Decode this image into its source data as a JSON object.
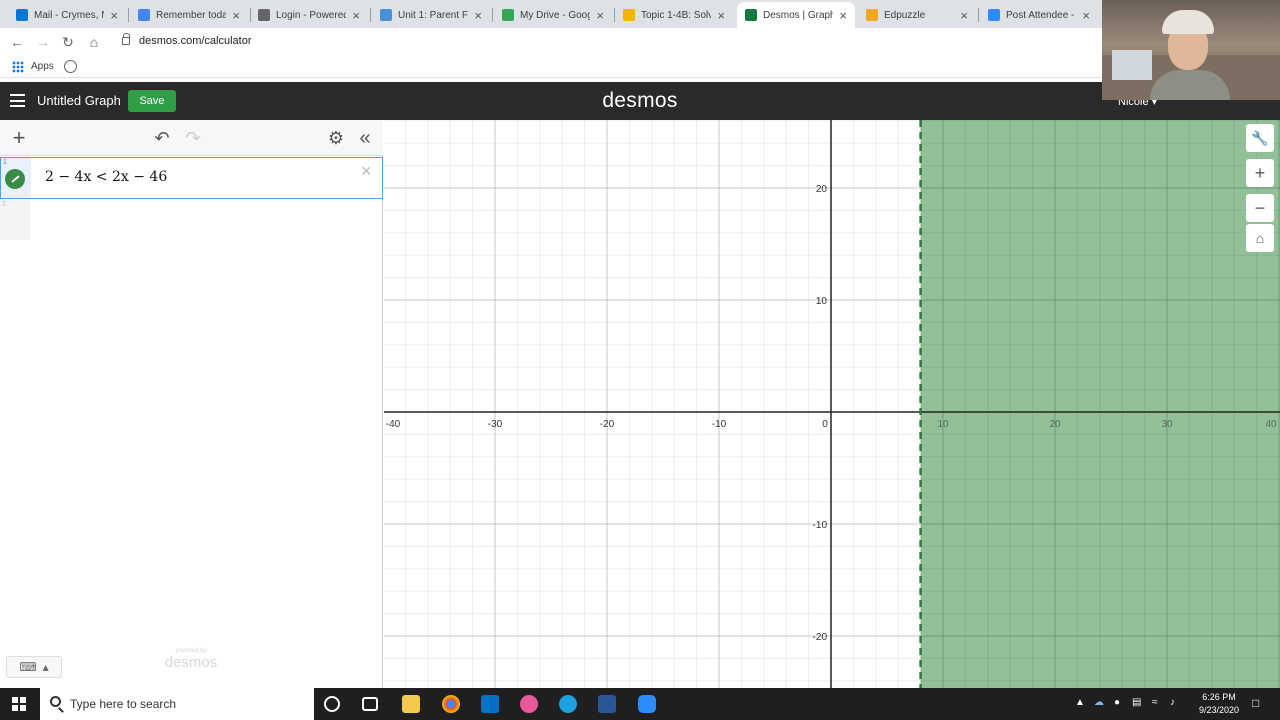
{
  "browser": {
    "tabs": [
      {
        "title": "Mail - Crymes, N",
        "color": "#0078d4"
      },
      {
        "title": "Remember toda",
        "color": "#4285f4"
      },
      {
        "title": "Login - Powered",
        "color": "#666666"
      },
      {
        "title": "Unit 1: Parent Fu",
        "color": "#4a90d9"
      },
      {
        "title": "My Drive - Goog",
        "color": "#34a853"
      },
      {
        "title": "Topic 1-4B: Solv",
        "color": "#f4b400"
      },
      {
        "title": "Desmos | Graph",
        "color": "#127a3d"
      },
      {
        "title": "Edpuzzle",
        "color": "#f5a623"
      },
      {
        "title": "Post Attendee -",
        "color": "#2d8cff"
      }
    ],
    "url": "desmos.com/calculator",
    "bookmarks": {
      "apps_label": "Apps"
    }
  },
  "desmos": {
    "graph_title": "Untitled Graph",
    "save_label": "Save",
    "brand": "desmos",
    "user_name": "Nicole",
    "expressions": [
      {
        "index": "1",
        "latex": "2 − 4x < 2x − 46",
        "color": "#388c46"
      }
    ],
    "next_index": "2",
    "powered_by": "powered by",
    "powered_brand": "desmos"
  },
  "graph": {
    "x_range": [
      -40,
      40
    ],
    "y_range": [
      -25,
      25
    ],
    "x_ticks": [
      "-40",
      "-30",
      "-20",
      "-10",
      "0",
      "10",
      "20",
      "30",
      "40"
    ],
    "y_ticks": [
      "20",
      "10",
      "-10",
      "-20"
    ],
    "shade_boundary_x": 8,
    "shade_side": "right",
    "shade_color": "#388c46",
    "boundary_style": "dashed"
  },
  "taskbar": {
    "search_placeholder": "Type here to search",
    "time": "6:26 PM",
    "date": "9/23/2020"
  }
}
